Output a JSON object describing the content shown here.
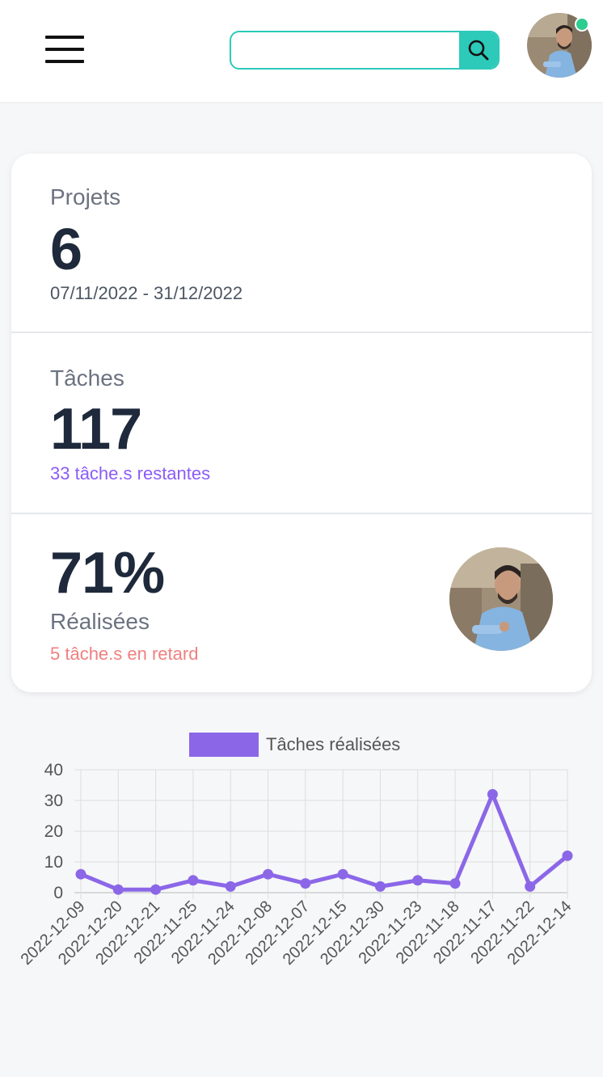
{
  "header": {
    "search": {
      "value": "",
      "placeholder": ""
    },
    "icons": {
      "menu": "hamburger-menu-icon",
      "search": "search-icon"
    },
    "avatar_status": "online"
  },
  "stats": {
    "projects": {
      "label": "Projets",
      "value": "6",
      "period": "07/11/2022 - 31/12/2022"
    },
    "tasks": {
      "label": "Tâches",
      "value": "117",
      "remaining": "33 tâche.s restantes"
    },
    "done": {
      "value": "71%",
      "label": "Réalisées",
      "late": "5 tâche.s en retard"
    }
  },
  "colors": {
    "accent": "#2dc9b9",
    "series": "#8b67e8",
    "remaining_text": "#8b5cf6",
    "late_text": "#f08080",
    "online": "#2ecc8f"
  },
  "chart_data": {
    "type": "line",
    "legend": [
      "Tâches réalisées"
    ],
    "legend_position": "top",
    "grid": true,
    "ylim": [
      0,
      40
    ],
    "yticks": [
      0,
      10,
      20,
      30,
      40
    ],
    "x": [
      "2022-12-09",
      "2022-12-20",
      "2022-12-21",
      "2022-11-25",
      "2022-11-24",
      "2022-12-08",
      "2022-12-07",
      "2022-12-15",
      "2022-12-30",
      "2022-11-23",
      "2022-11-18",
      "2022-11-17",
      "2022-11-22",
      "2022-12-14"
    ],
    "series": [
      {
        "name": "Tâches réalisées",
        "values": [
          6,
          1,
          1,
          4,
          2,
          6,
          3,
          6,
          2,
          4,
          3,
          32,
          2,
          12
        ]
      }
    ]
  }
}
